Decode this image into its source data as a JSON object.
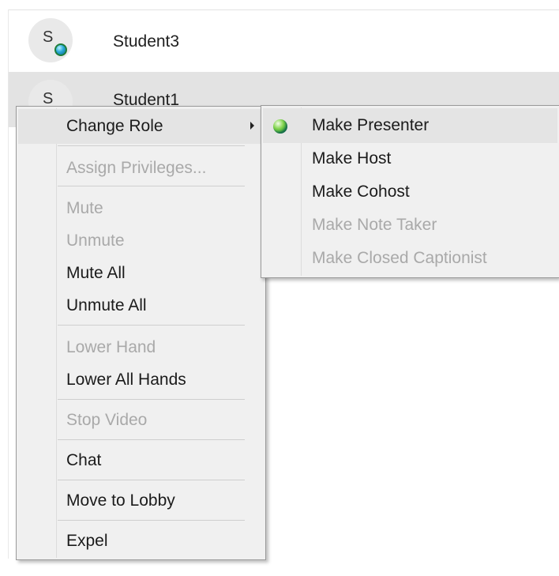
{
  "participants": [
    {
      "initial": "S",
      "name": "Student3"
    },
    {
      "initial": "S",
      "name": "Student1"
    }
  ],
  "context_menu": {
    "items": [
      {
        "label": "Change Role",
        "disabled": false,
        "has_submenu": true
      },
      {
        "label": "Assign Privileges...",
        "disabled": true
      },
      {
        "label": "Mute",
        "disabled": true
      },
      {
        "label": "Unmute",
        "disabled": true
      },
      {
        "label": "Mute All",
        "disabled": false
      },
      {
        "label": "Unmute All",
        "disabled": false
      },
      {
        "label": "Lower Hand",
        "disabled": true
      },
      {
        "label": "Lower All Hands",
        "disabled": false
      },
      {
        "label": "Stop Video",
        "disabled": true
      },
      {
        "label": "Chat",
        "disabled": false
      },
      {
        "label": "Move to Lobby",
        "disabled": false
      },
      {
        "label": "Expel",
        "disabled": false
      }
    ]
  },
  "role_submenu": {
    "items": [
      {
        "label": "Make Presenter",
        "disabled": false,
        "icon": "presenter-ball-icon"
      },
      {
        "label": "Make Host",
        "disabled": false
      },
      {
        "label": "Make Cohost",
        "disabled": false
      },
      {
        "label": "Make Note Taker",
        "disabled": true
      },
      {
        "label": "Make Closed Captionist",
        "disabled": true
      }
    ]
  },
  "colors": {
    "menu_background": "#f0f0f0",
    "disabled_text": "#a9a9a9",
    "selected_row": "#e3e3e3"
  }
}
